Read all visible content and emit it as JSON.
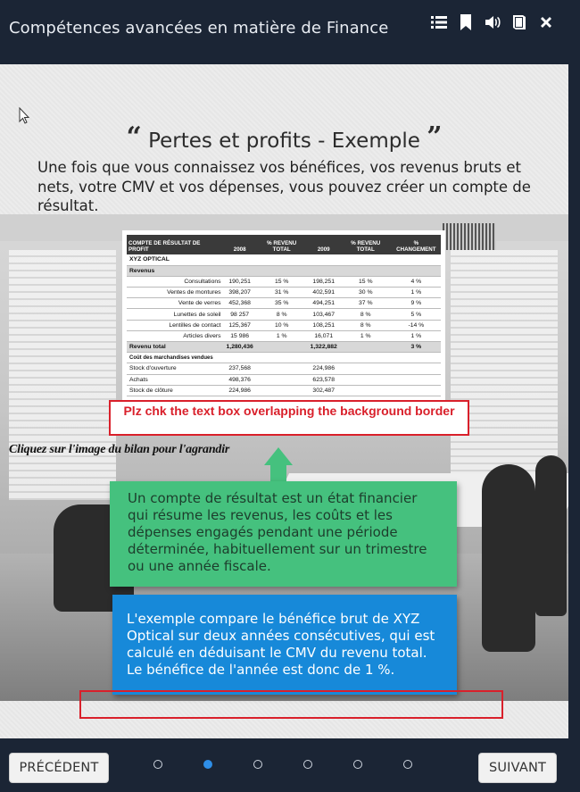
{
  "header": {
    "title": "Compétences avancées en matière de Finance",
    "icons": [
      "menu-list-icon",
      "bookmark-icon",
      "volume-icon",
      "book-icon",
      "close-icon"
    ]
  },
  "slide": {
    "heading": "Pertes et profits - Exemple",
    "quote_open": "“",
    "quote_close": "”",
    "intro": "Une fois que vous connaissez vos bénéfices, vos revenus bruts et nets, votre CMV et vos dépenses, vous pouvez créer un compte de résultat.",
    "table": {
      "headers": [
        "COMPTE DE RÉSULTAT DE PROFIT",
        "2008",
        "% REVENU TOTAL",
        "2009",
        "% REVENU TOTAL",
        "% CHANGEMENT"
      ],
      "company": "XYZ OPTICAL",
      "section_revenue": "Revenus",
      "rows": [
        [
          "Consultations",
          "190,251",
          "15 %",
          "198,251",
          "15 %",
          "4 %"
        ],
        [
          "Ventes de montures",
          "398,207",
          "31 %",
          "402,591",
          "30 %",
          "1 %"
        ],
        [
          "Vente de verres",
          "452,368",
          "35 %",
          "494,251",
          "37 %",
          "9 %"
        ],
        [
          "Lunettes de soleil",
          "98 257",
          "8 %",
          "103,467",
          "8 %",
          "5 %"
        ],
        [
          "Lentilles de contact",
          "125,367",
          "10 %",
          "108,251",
          "8 %",
          "-14 %"
        ],
        [
          "Articles divers",
          "15 986",
          "1 %",
          "16,071",
          "1 %",
          "1 %"
        ]
      ],
      "total_row": [
        "Revenu total",
        "1,280,436",
        "",
        "1,322,882",
        "",
        "3 %"
      ],
      "section_cogs": "Coût des marchandises vendues",
      "cogs_rows": [
        [
          "Stock d'ouverture",
          "237,568",
          "",
          "224,986",
          "",
          ""
        ],
        [
          "Achats",
          "498,376",
          "",
          "623,578",
          "",
          ""
        ],
        [
          "Stock de clôture",
          "224,986",
          "",
          "302,487",
          "",
          ""
        ]
      ]
    },
    "review_note": "Plz chk the text box overlapping the background border",
    "click_hint": "Cliquez sur l'image du bilan pour l'agrandir",
    "green_text": "Un compte de résultat est un état financier qui résume les revenus, les coûts et les dépenses engagés pendant une période déterminée, habituellement sur un trimestre ou une année fiscale.",
    "blue_text": "L'exemple compare le bénéfice brut de XYZ Optical sur deux années consécutives, qui est calculé en déduisant le CMV du revenu total. Le bénéfice de l'année est donc de 1 %."
  },
  "footer": {
    "prev_label": "PRÉCÉDENT",
    "next_label": "SUIVANT",
    "page_count": 6,
    "active_page": 2
  },
  "colors": {
    "header_bg": "#1b2535",
    "green": "#45c17e",
    "blue": "#1789d9",
    "review_red": "#d9202b",
    "active_dot": "#2f8fe8"
  }
}
